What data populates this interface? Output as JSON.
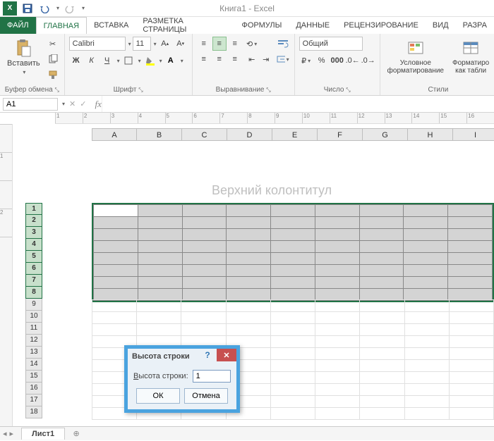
{
  "title": "Книга1 - Excel",
  "qat": {
    "save": "💾",
    "undo": "↶",
    "redo": "↷"
  },
  "tabs": {
    "file": "ФАЙЛ",
    "list": [
      "ГЛАВНАЯ",
      "ВСТАВКА",
      "РАЗМЕТКА СТРАНИЦЫ",
      "ФОРМУЛЫ",
      "ДАННЫЕ",
      "РЕЦЕНЗИРОВАНИЕ",
      "ВИД",
      "РАЗРА"
    ]
  },
  "ribbon": {
    "clipboard": {
      "paste": "Вставить",
      "label": "Буфер обмена"
    },
    "font": {
      "name": "Calibri",
      "size": "11",
      "label": "Шрифт",
      "bold": "Ж",
      "italic": "К",
      "underline": "Ч"
    },
    "align": {
      "label": "Выравнивание"
    },
    "number": {
      "format": "Общий",
      "label": "Число"
    },
    "styles": {
      "cond": "Условное\nформатирование",
      "table": "Форматиро\nкак табли",
      "label": "Стили"
    }
  },
  "namebox": "A1",
  "header_text": "Верхний колонтитул",
  "columns": [
    "A",
    "B",
    "C",
    "D",
    "E",
    "F",
    "G",
    "H",
    "I"
  ],
  "rows_sel": [
    1,
    2,
    3,
    4,
    5,
    6,
    7,
    8
  ],
  "rows_rest": [
    9,
    10,
    11,
    12,
    13,
    14,
    15,
    16,
    17,
    18
  ],
  "dialog": {
    "title": "Высота строки",
    "label": "Высота строки:",
    "value": "1",
    "ok": "ОК",
    "cancel": "Отмена"
  },
  "sheet_tab": "Лист1"
}
